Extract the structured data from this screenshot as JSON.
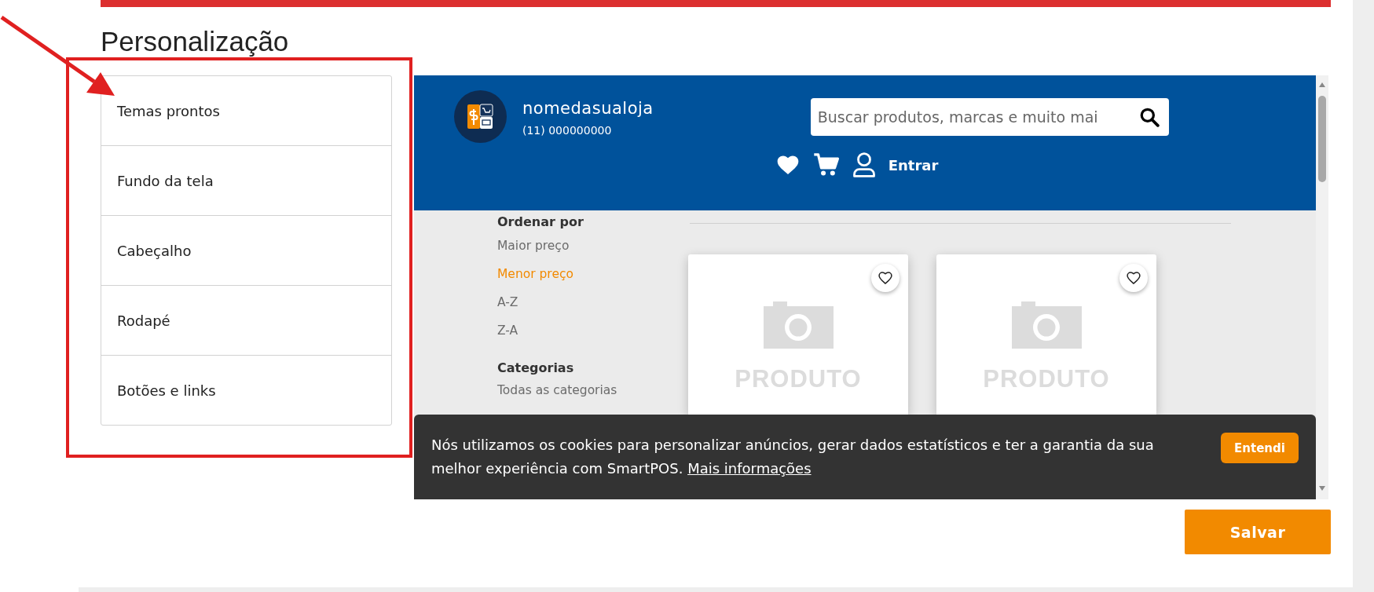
{
  "page": {
    "title": "Personalização"
  },
  "sidebar": {
    "items": [
      {
        "label": "Temas prontos"
      },
      {
        "label": "Fundo da tela"
      },
      {
        "label": "Cabeçalho"
      },
      {
        "label": "Rodapé"
      },
      {
        "label": "Botões e links"
      }
    ]
  },
  "preview": {
    "store": {
      "name": "nomedasualoja",
      "phone": "(11) 000000000"
    },
    "search": {
      "placeholder": "Buscar produtos, marcas e muito mai"
    },
    "login": "Entrar",
    "sort": {
      "title": "Ordenar por",
      "options": [
        {
          "label": "Maior preço",
          "selected": false
        },
        {
          "label": "Menor preço",
          "selected": true
        },
        {
          "label": "A-Z",
          "selected": false
        },
        {
          "label": "Z-A",
          "selected": false
        }
      ]
    },
    "categories": {
      "title": "Categorias",
      "items": [
        "Todas as categorias"
      ]
    },
    "products": [
      {
        "image_text": "PRODUTO"
      },
      {
        "image_text": "PRODUTO"
      }
    ],
    "cookie_bar": {
      "text": "Nós utilizamos os cookies para personalizar anúncios, gerar dados estatísticos e ter a garantia da sua melhor experiência com SmartPOS.",
      "link": "Mais informações",
      "button": "Entendi"
    }
  },
  "save_button": "Salvar"
}
